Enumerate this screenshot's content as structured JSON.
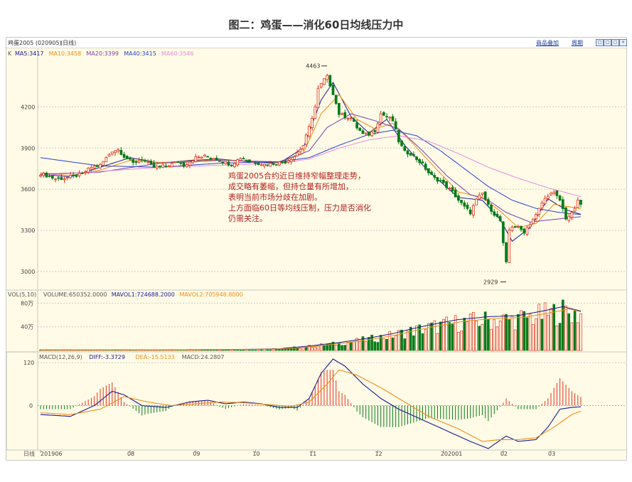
{
  "page_title": "图二：鸡蛋——消化60日均线压力中",
  "header": {
    "symbol": "鸡蛋2005 (020905)",
    "period_tag": "(日线)",
    "link_overlay": "商品叠加",
    "link_period": "周期",
    "window_buttons": [
      "□",
      "□",
      "□",
      "×"
    ]
  },
  "chart_data": [
    {
      "type": "candlestick",
      "title": "",
      "panel_label": "K",
      "ma_legend": [
        {
          "label": "MA5:3417",
          "color": "#1a1a8c"
        },
        {
          "label": "MA10:3458",
          "color": "#f08c18"
        },
        {
          "label": "MA20:3399",
          "color": "#7a3fb0"
        },
        {
          "label": "MA40:3415",
          "color": "#2a3fd0"
        },
        {
          "label": "MA60:3546",
          "color": "#e58be0"
        }
      ],
      "y_ticks": [
        4200,
        3900,
        3600,
        3300,
        3000
      ],
      "ylim": [
        2880,
        4560
      ],
      "high_marker": {
        "label": "4463",
        "value": 4463
      },
      "low_marker": {
        "label": "2929",
        "value": 2929
      },
      "annotation": [
        "鸡蛋2005合约近日维持窄幅整理走势，",
        "成交略有萎缩，但持仓量有所增加，",
        "表明当前市场分歧在加剧。",
        "上方面临60日等均线压制，压力是否消化",
        "仍需关注。"
      ],
      "price_path": [
        [
          0,
          3715
        ],
        [
          5,
          3675
        ],
        [
          8,
          3680
        ],
        [
          14,
          3710
        ],
        [
          17,
          3760
        ],
        [
          20,
          3775
        ],
        [
          24,
          3880
        ],
        [
          26,
          3890
        ],
        [
          28,
          3840
        ],
        [
          31,
          3790
        ],
        [
          34,
          3820
        ],
        [
          38,
          3760
        ],
        [
          42,
          3770
        ],
        [
          46,
          3800
        ],
        [
          48,
          3775
        ],
        [
          52,
          3830
        ],
        [
          55,
          3840
        ],
        [
          58,
          3830
        ],
        [
          61,
          3800
        ],
        [
          64,
          3780
        ],
        [
          67,
          3830
        ],
        [
          71,
          3800
        ],
        [
          75,
          3780
        ],
        [
          79,
          3790
        ],
        [
          82,
          3800
        ],
        [
          85,
          3840
        ],
        [
          88,
          3920
        ],
        [
          90,
          4050
        ],
        [
          92,
          4200
        ],
        [
          93,
          4330
        ],
        [
          95,
          4400
        ],
        [
          96,
          4420
        ],
        [
          98,
          4300
        ],
        [
          100,
          4150
        ],
        [
          102,
          4130
        ],
        [
          104,
          4120
        ],
        [
          106,
          4050
        ],
        [
          108,
          4000
        ],
        [
          110,
          4000
        ],
        [
          112,
          4030
        ],
        [
          114,
          4150
        ],
        [
          116,
          4130
        ],
        [
          118,
          4100
        ],
        [
          120,
          3950
        ],
        [
          122,
          3870
        ],
        [
          124,
          3860
        ],
        [
          126,
          3820
        ],
        [
          128,
          3780
        ],
        [
          130,
          3720
        ],
        [
          132,
          3680
        ],
        [
          134,
          3660
        ],
        [
          136,
          3620
        ],
        [
          138,
          3580
        ],
        [
          140,
          3520
        ],
        [
          142,
          3470
        ],
        [
          144,
          3430
        ],
        [
          146,
          3520
        ],
        [
          148,
          3570
        ],
        [
          150,
          3480
        ],
        [
          152,
          3420
        ],
        [
          154,
          3370
        ],
        [
          155,
          3200
        ],
        [
          156,
          3060
        ],
        [
          157,
          3300
        ],
        [
          158,
          3330
        ],
        [
          160,
          3320
        ],
        [
          162,
          3290
        ],
        [
          164,
          3350
        ],
        [
          166,
          3410
        ],
        [
          168,
          3500
        ],
        [
          170,
          3560
        ],
        [
          172,
          3570
        ],
        [
          174,
          3520
        ],
        [
          176,
          3390
        ],
        [
          178,
          3420
        ],
        [
          180,
          3510
        ],
        [
          181,
          3490
        ]
      ],
      "ma_paths": {
        "MA5": [
          [
            0,
            3710
          ],
          [
            10,
            3690
          ],
          [
            20,
            3760
          ],
          [
            30,
            3830
          ],
          [
            40,
            3790
          ],
          [
            50,
            3810
          ],
          [
            60,
            3820
          ],
          [
            70,
            3800
          ],
          [
            80,
            3790
          ],
          [
            88,
            3900
          ],
          [
            94,
            4250
          ],
          [
            98,
            4380
          ],
          [
            104,
            4130
          ],
          [
            110,
            4010
          ],
          [
            116,
            4110
          ],
          [
            122,
            3920
          ],
          [
            130,
            3730
          ],
          [
            140,
            3540
          ],
          [
            148,
            3520
          ],
          [
            154,
            3380
          ],
          [
            158,
            3220
          ],
          [
            164,
            3320
          ],
          [
            170,
            3530
          ],
          [
            176,
            3450
          ],
          [
            181,
            3417
          ]
        ],
        "MA10": [
          [
            0,
            3720
          ],
          [
            10,
            3700
          ],
          [
            20,
            3740
          ],
          [
            30,
            3810
          ],
          [
            40,
            3795
          ],
          [
            50,
            3805
          ],
          [
            60,
            3815
          ],
          [
            70,
            3805
          ],
          [
            80,
            3795
          ],
          [
            88,
            3860
          ],
          [
            94,
            4150
          ],
          [
            100,
            4290
          ],
          [
            106,
            4110
          ],
          [
            112,
            4040
          ],
          [
            118,
            4080
          ],
          [
            124,
            3950
          ],
          [
            132,
            3760
          ],
          [
            140,
            3580
          ],
          [
            148,
            3540
          ],
          [
            154,
            3440
          ],
          [
            160,
            3320
          ],
          [
            166,
            3350
          ],
          [
            172,
            3490
          ],
          [
            181,
            3458
          ]
        ],
        "MA20": [
          [
            0,
            3710
          ],
          [
            20,
            3725
          ],
          [
            40,
            3790
          ],
          [
            60,
            3810
          ],
          [
            80,
            3800
          ],
          [
            90,
            3880
          ],
          [
            96,
            4050
          ],
          [
            104,
            4150
          ],
          [
            112,
            4100
          ],
          [
            120,
            4040
          ],
          [
            128,
            3880
          ],
          [
            136,
            3700
          ],
          [
            144,
            3560
          ],
          [
            150,
            3520
          ],
          [
            156,
            3430
          ],
          [
            164,
            3360
          ],
          [
            172,
            3380
          ],
          [
            181,
            3399
          ]
        ],
        "MA40": [
          [
            0,
            3830
          ],
          [
            20,
            3770
          ],
          [
            40,
            3760
          ],
          [
            60,
            3790
          ],
          [
            80,
            3800
          ],
          [
            90,
            3830
          ],
          [
            100,
            3920
          ],
          [
            110,
            4000
          ],
          [
            118,
            4030
          ],
          [
            126,
            3990
          ],
          [
            134,
            3880
          ],
          [
            142,
            3750
          ],
          [
            150,
            3620
          ],
          [
            158,
            3520
          ],
          [
            166,
            3460
          ],
          [
            174,
            3430
          ],
          [
            181,
            3415
          ]
        ],
        "MA60": [
          [
            0,
            3700
          ],
          [
            20,
            3730
          ],
          [
            40,
            3760
          ],
          [
            60,
            3775
          ],
          [
            80,
            3790
          ],
          [
            90,
            3820
          ],
          [
            100,
            3900
          ],
          [
            110,
            3960
          ],
          [
            120,
            3990
          ],
          [
            130,
            3950
          ],
          [
            140,
            3860
          ],
          [
            150,
            3760
          ],
          [
            160,
            3680
          ],
          [
            170,
            3610
          ],
          [
            181,
            3546
          ]
        ]
      }
    },
    {
      "type": "bar",
      "title": "",
      "legend": [
        {
          "label": "VOL(5,10)",
          "color": "#555555"
        },
        {
          "label": "VOLUME:650352.0000",
          "color": "#555555"
        },
        {
          "label": "MAVOL1:724688.2000",
          "color": "#1a1a8c"
        },
        {
          "label": "MAVOL2:705948.8000",
          "color": "#f08c18"
        }
      ],
      "y_ticks": [
        "80万",
        "40万"
      ],
      "y_tick_values": [
        80,
        40
      ],
      "ylim": [
        0,
        96
      ],
      "unit": "万",
      "volume_envelope": [
        [
          0,
          1
        ],
        [
          40,
          1
        ],
        [
          70,
          2
        ],
        [
          80,
          3
        ],
        [
          90,
          8
        ],
        [
          100,
          14
        ],
        [
          110,
          22
        ],
        [
          118,
          30
        ],
        [
          124,
          38
        ],
        [
          130,
          45
        ],
        [
          140,
          55
        ],
        [
          150,
          60
        ],
        [
          160,
          62
        ],
        [
          170,
          72
        ],
        [
          175,
          78
        ],
        [
          181,
          70
        ]
      ]
    },
    {
      "type": "line",
      "title": "",
      "legend": [
        {
          "label": "MACD(12,26,9)",
          "color": "#555555"
        },
        {
          "label": "DIFF:-3.3729",
          "color": "#1a1a8c"
        },
        {
          "label": "DEA:-15.5133",
          "color": "#f08c18"
        },
        {
          "label": "MACD:24.2807",
          "color": "#555555"
        }
      ],
      "y_ticks": [
        120,
        0
      ],
      "ylim": [
        -120,
        140
      ],
      "diff": [
        [
          0,
          -25
        ],
        [
          10,
          -30
        ],
        [
          18,
          0
        ],
        [
          24,
          40
        ],
        [
          28,
          30
        ],
        [
          34,
          0
        ],
        [
          42,
          -5
        ],
        [
          50,
          10
        ],
        [
          56,
          15
        ],
        [
          62,
          5
        ],
        [
          68,
          10
        ],
        [
          74,
          5
        ],
        [
          80,
          -5
        ],
        [
          86,
          -5
        ],
        [
          90,
          20
        ],
        [
          94,
          90
        ],
        [
          98,
          130
        ],
        [
          102,
          110
        ],
        [
          108,
          60
        ],
        [
          114,
          20
        ],
        [
          120,
          -10
        ],
        [
          128,
          -40
        ],
        [
          136,
          -70
        ],
        [
          144,
          -100
        ],
        [
          150,
          -120
        ],
        [
          156,
          -85
        ],
        [
          160,
          -100
        ],
        [
          166,
          -95
        ],
        [
          170,
          -60
        ],
        [
          174,
          -10
        ],
        [
          178,
          -5
        ],
        [
          181,
          -3.37
        ]
      ],
      "dea": [
        [
          0,
          -20
        ],
        [
          10,
          -25
        ],
        [
          20,
          -10
        ],
        [
          28,
          25
        ],
        [
          36,
          10
        ],
        [
          44,
          0
        ],
        [
          52,
          5
        ],
        [
          60,
          10
        ],
        [
          68,
          8
        ],
        [
          76,
          3
        ],
        [
          84,
          -2
        ],
        [
          90,
          10
        ],
        [
          96,
          60
        ],
        [
          100,
          100
        ],
        [
          106,
          85
        ],
        [
          114,
          50
        ],
        [
          122,
          10
        ],
        [
          130,
          -30
        ],
        [
          140,
          -65
        ],
        [
          148,
          -100
        ],
        [
          154,
          -95
        ],
        [
          160,
          -95
        ],
        [
          166,
          -90
        ],
        [
          172,
          -60
        ],
        [
          178,
          -25
        ],
        [
          181,
          -15.51
        ]
      ]
    }
  ],
  "x_axis": {
    "label": "日线",
    "ticks": [
      "201906",
      "08",
      "09",
      "10",
      "11",
      "12",
      "202001",
      "02",
      "03"
    ],
    "tick_index": [
      0,
      30,
      52,
      72,
      91,
      113,
      135,
      155,
      171
    ],
    "n_bars": 182
  }
}
